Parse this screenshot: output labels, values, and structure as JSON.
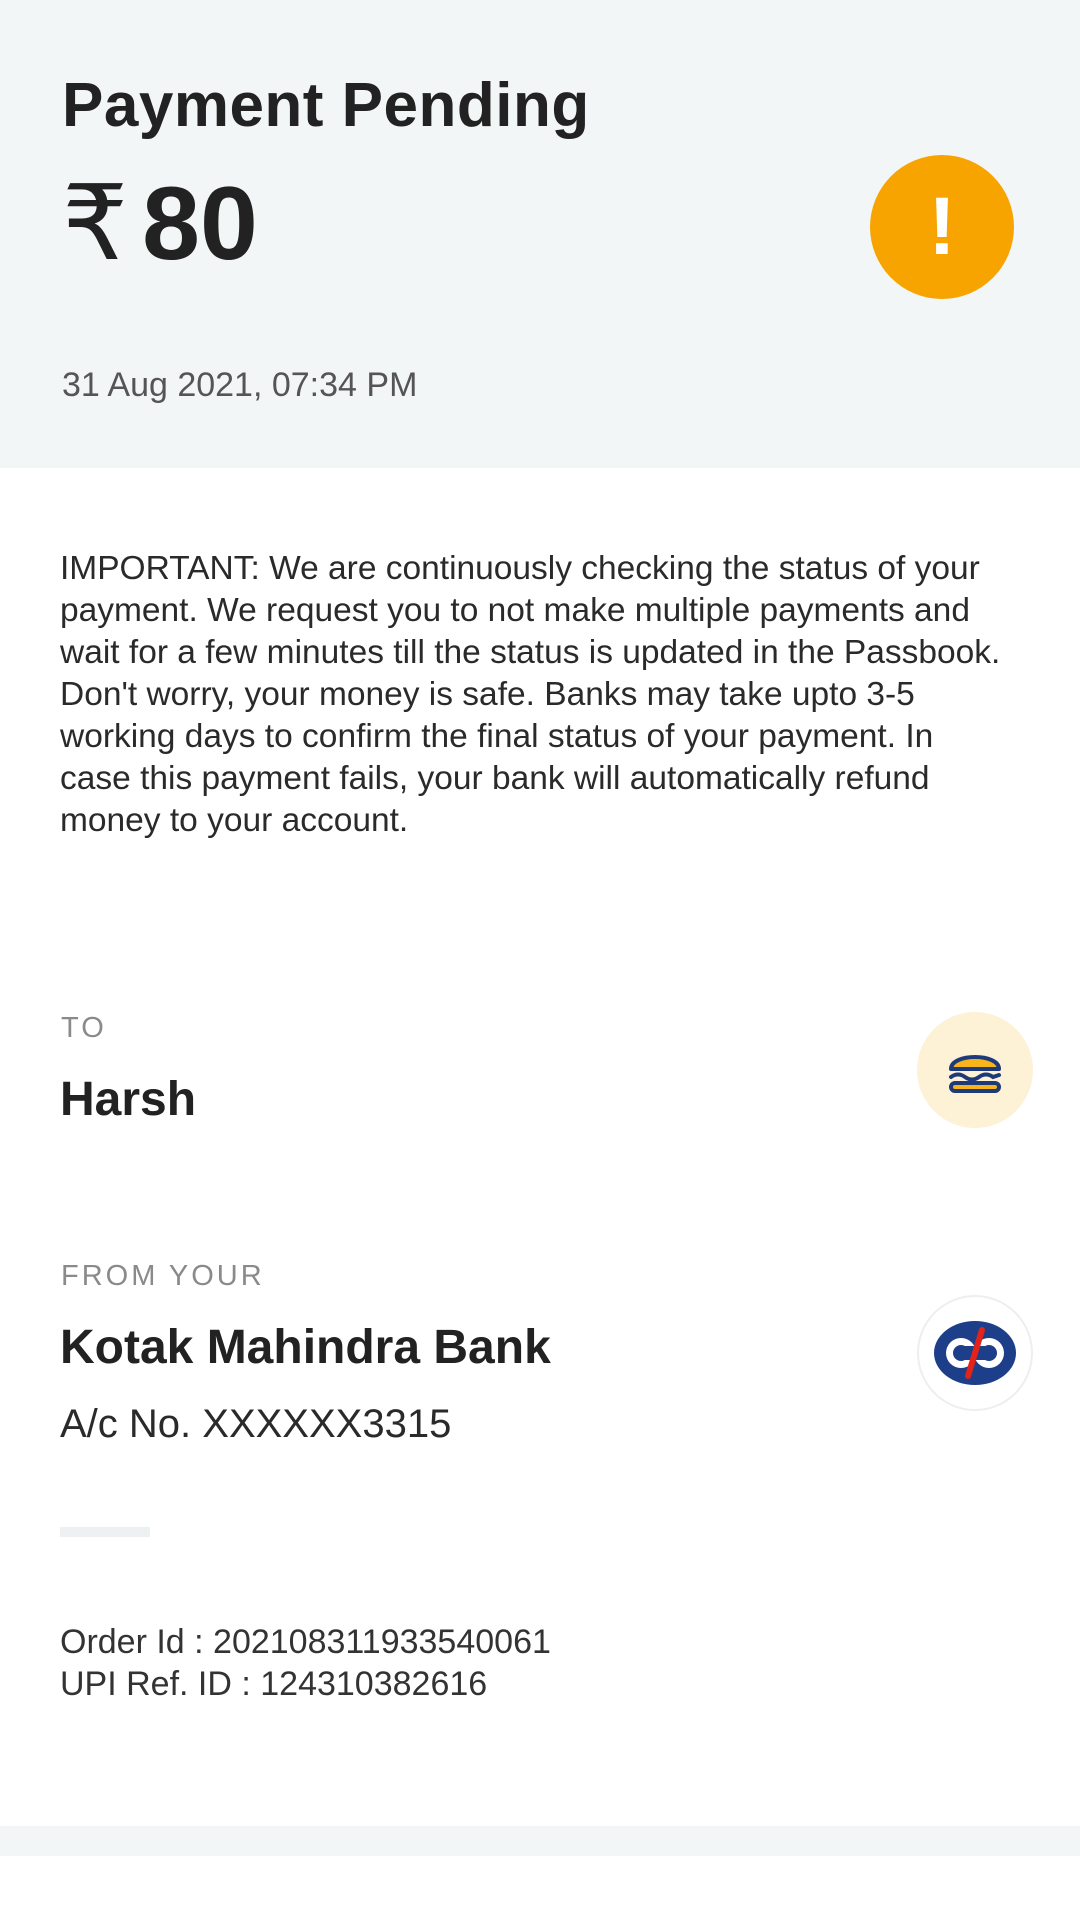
{
  "header": {
    "title": "Payment Pending",
    "currency_symbol": "₹",
    "amount": "80",
    "datetime": "31 Aug 2021, 07:34 PM",
    "status_icon": "exclamation-icon",
    "status_color": "#f7a400"
  },
  "notice": {
    "paragraph1": "IMPORTANT: We are continuously checking the status of your payment. We request you to not make multiple payments and wait for a few minutes till the status is updated in the Passbook.",
    "paragraph2": "Don't worry, your money is safe. Banks may take upto 3-5 working days to confirm the final status of your payment. In case this payment fails, your bank will automatically refund money to your account."
  },
  "payee": {
    "label": "TO",
    "name": "Harsh",
    "avatar_icon": "burger-icon"
  },
  "source": {
    "label": "FROM YOUR",
    "bank_name": "Kotak Mahindra Bank",
    "account": "A/c No. XXXXXX3315",
    "logo_icon": "kotak-logo-icon"
  },
  "ids": {
    "order_id": "Order Id : 20210831193354006​1",
    "upi_ref": "UPI Ref. ID : 124310382616"
  }
}
